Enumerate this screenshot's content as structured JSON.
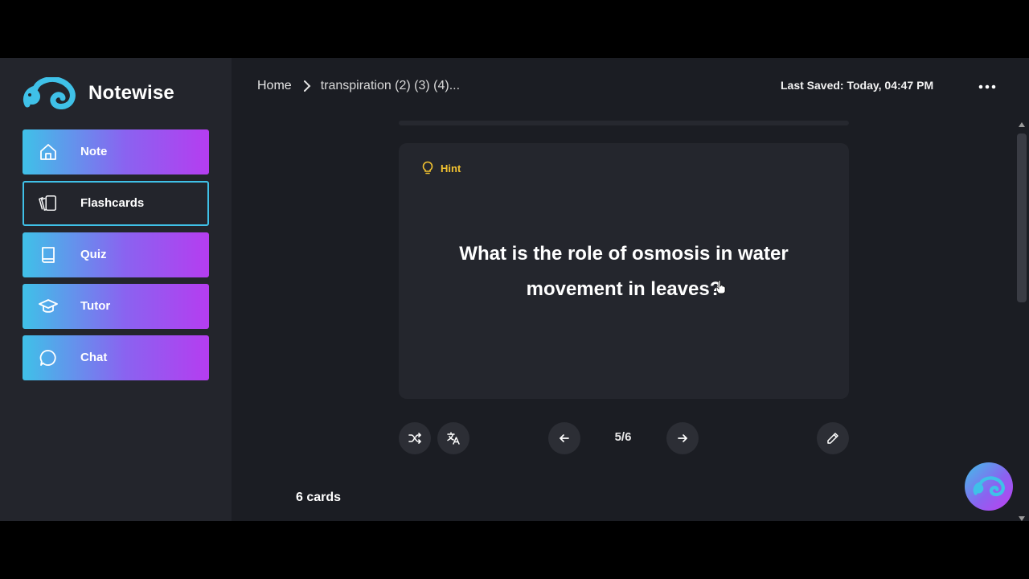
{
  "app": {
    "name": "Notewise"
  },
  "sidebar": {
    "items": [
      {
        "label": "Note",
        "icon": "home-icon",
        "active": false
      },
      {
        "label": "Flashcards",
        "icon": "flashcards-icon",
        "active": true
      },
      {
        "label": "Quiz",
        "icon": "book-icon",
        "active": false
      },
      {
        "label": "Tutor",
        "icon": "graduation-cap-icon",
        "active": false
      },
      {
        "label": "Chat",
        "icon": "chat-bubble-icon",
        "active": false
      }
    ]
  },
  "header": {
    "breadcrumb": {
      "home": "Home",
      "current": "transpiration (2) (3) (4)..."
    },
    "last_saved": "Last Saved: Today, 04:47 PM",
    "more_icon": "more-horizontal-icon"
  },
  "card": {
    "hint_label": "Hint",
    "question": "What is the role of osmosis in water movement in leaves?"
  },
  "controls": {
    "counter": "5/6",
    "shuffle_icon": "shuffle-icon",
    "translate_icon": "translate-icon",
    "prev_icon": "arrow-left-icon",
    "next_icon": "arrow-right-icon",
    "edit_icon": "pencil-icon"
  },
  "footer": {
    "card_count": "6 cards"
  },
  "colors": {
    "accent_start": "#3fc1e8",
    "accent_end": "#b53df0",
    "hint": "#f2c230",
    "background": "#1b1d23",
    "sidebar": "#23252c"
  }
}
